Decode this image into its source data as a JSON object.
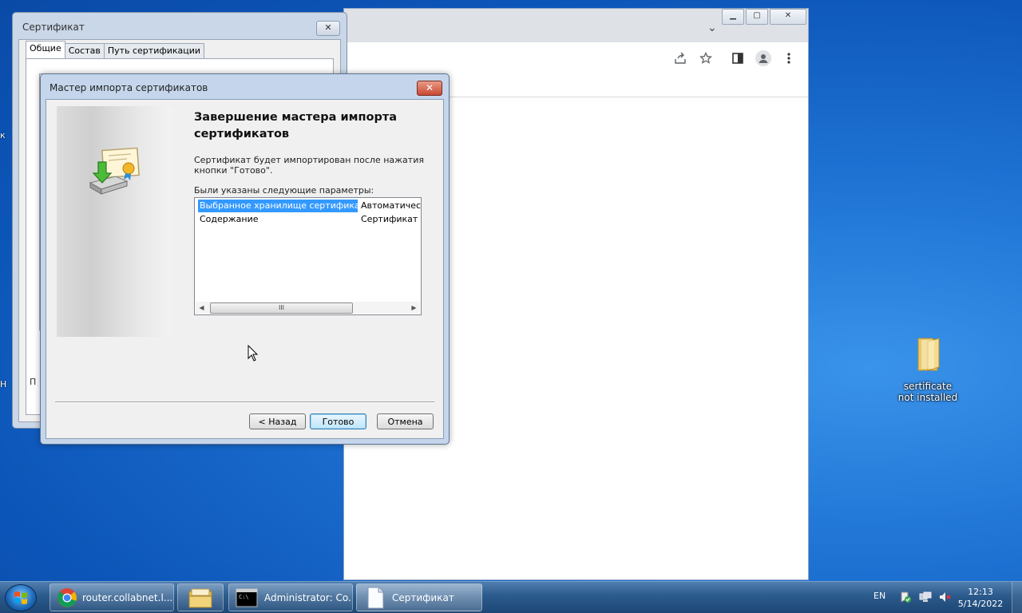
{
  "desktop": {
    "edge_letters": [
      "к",
      "Н"
    ],
    "folder_icon": {
      "label_line1": "sertificate",
      "label_line2": "not installed",
      "icon": "folder-icon"
    }
  },
  "chrome": {
    "controls": {
      "minimize": "▁",
      "maximize": "▢",
      "close": "✕"
    },
    "tab_chevron": "⌄",
    "toolbar_icons": [
      "share-icon",
      "star-icon",
      "side-panel-icon",
      "profile-icon",
      "menu-icon"
    ]
  },
  "cert_properties": {
    "title": "Сертификат",
    "close": "✕",
    "tabs": [
      {
        "label": "Общие"
      },
      {
        "label": "Состав"
      },
      {
        "label": "Путь сертификации"
      }
    ],
    "partial_text": "П"
  },
  "wizard": {
    "title": "Мастер импорта сертификатов",
    "close": "✕",
    "heading": "Завершение мастера импорта сертификатов",
    "description": "Сертификат будет импортирован после нажатия кнопки \"Готово\".",
    "params_label": "Были указаны следующие параметры:",
    "params": [
      {
        "name": "Выбранное хранилище сертификатов",
        "value": "Автоматическ"
      },
      {
        "name": "Содержание",
        "value": "Сертификат"
      }
    ],
    "scroll": {
      "left": "◀",
      "right": "▶",
      "grip": "III"
    },
    "buttons": {
      "back": "< Назад",
      "finish": "Готово",
      "cancel": "Отмена"
    }
  },
  "taskbar": {
    "items": [
      {
        "label": "router.collabnet.l...",
        "icon": "chrome-icon"
      },
      {
        "label": "",
        "icon": "explorer-icon"
      },
      {
        "label": "Administrator: Co...",
        "icon": "cmd-icon"
      },
      {
        "label": "Сертификат",
        "icon": "document-icon"
      }
    ],
    "language": "EN",
    "time": "12:13",
    "date": "5/14/2022"
  }
}
